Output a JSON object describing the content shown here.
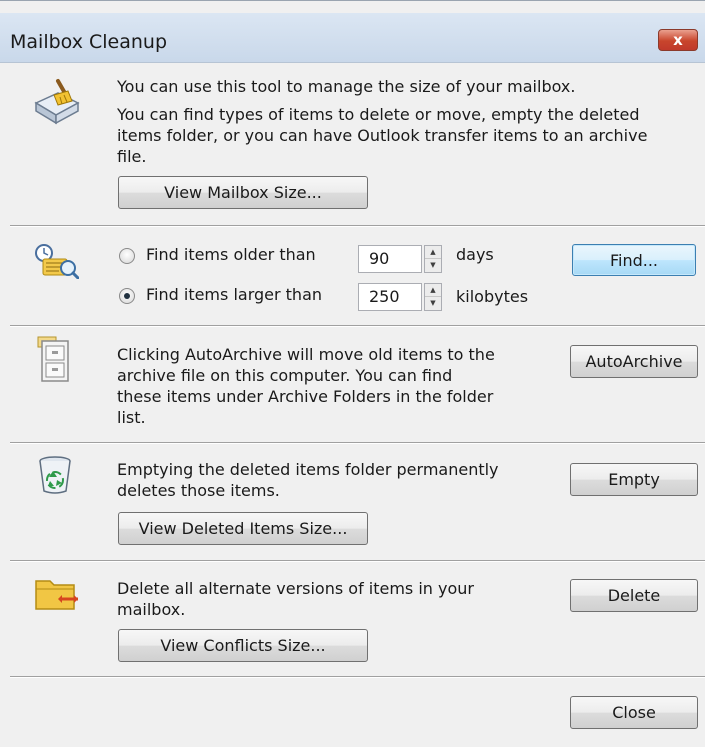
{
  "window": {
    "title": "Mailbox Cleanup",
    "close_glyph": "x"
  },
  "intro": {
    "line1": "You can use this tool to manage the size of your mailbox.",
    "line2a": "You can find types of items to delete or move, empty the deleted",
    "line2b": "items folder, or you can have Outlook transfer items to an archive",
    "line2c": "file.",
    "view_mailbox_size": "View Mailbox Size..."
  },
  "find": {
    "older_label": "Find items older than",
    "older_value": "90",
    "older_unit": "days",
    "larger_label": "Find items larger than",
    "larger_value": "250",
    "larger_unit": "kilobytes",
    "selected_option": "larger",
    "find_button": "Find..."
  },
  "autoarchive": {
    "line1": "Clicking AutoArchive will move old items to the",
    "line2": "archive file on this computer. You can find",
    "line3": "these items under Archive Folders in the folder",
    "line4": "list.",
    "button": "AutoArchive"
  },
  "deleted": {
    "line1": "Emptying the deleted items folder permanently",
    "line2": "deletes those items.",
    "empty_button": "Empty",
    "view_button": "View Deleted Items Size..."
  },
  "conflicts": {
    "line1": "Delete all alternate versions of items in your",
    "line2": "mailbox.",
    "delete_button": "Delete",
    "view_button": "View Conflicts Size..."
  },
  "footer": {
    "close_button": "Close"
  },
  "icons": [
    "mailbox-cleanup-icon",
    "find-items-icon",
    "autoarchive-cabinet-icon",
    "recycle-bin-icon",
    "conflicts-folder-icon"
  ],
  "colors": {
    "focus_border": "#3c7fb1",
    "close_red": "#c0392b"
  }
}
